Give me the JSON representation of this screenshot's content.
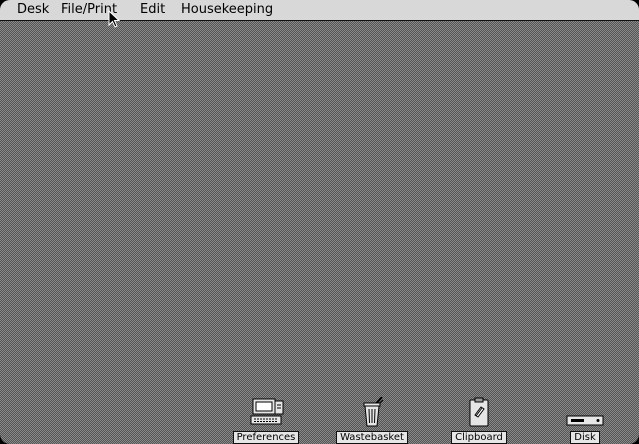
{
  "menubar": {
    "items": [
      {
        "label": "Desk"
      },
      {
        "label": "File/Print"
      },
      {
        "label": "Edit"
      },
      {
        "label": "Housekeeping"
      }
    ]
  },
  "desktop": {
    "icons": [
      {
        "label": "Preferences",
        "icon": "computer-icon"
      },
      {
        "label": "Wastebasket",
        "icon": "wastebasket-icon"
      },
      {
        "label": "Clipboard",
        "icon": "clipboard-icon"
      },
      {
        "label": "Disk",
        "icon": "disk-icon"
      }
    ]
  },
  "colors": {
    "menubar_bg": "#d8d8d8",
    "desktop_pattern": "#8a8a8a",
    "label_bg": "#e6e6e6",
    "ink": "#000000"
  }
}
